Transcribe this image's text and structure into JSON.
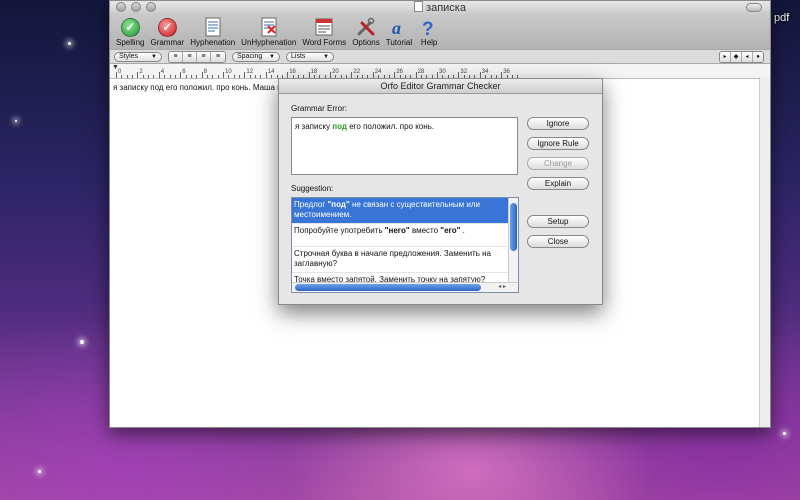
{
  "desktop": {
    "label": "pdf"
  },
  "window": {
    "title": "записка",
    "toolbar": [
      {
        "id": "spelling",
        "label": "Spelling",
        "icon": "spelling-check-icon"
      },
      {
        "id": "grammar",
        "label": "Grammar",
        "icon": "grammar-check-icon"
      },
      {
        "id": "hyphenation",
        "label": "Hyphenation",
        "icon": "hyphenation-icon"
      },
      {
        "id": "unhyphenation",
        "label": "UnHyphenation",
        "icon": "unhyphenation-icon"
      },
      {
        "id": "wordforms",
        "label": "Word Forms",
        "icon": "word-forms-icon"
      },
      {
        "id": "options",
        "label": "Options",
        "icon": "tools-icon"
      },
      {
        "id": "tutorial",
        "label": "Tutorial",
        "icon": "tutorial-icon"
      },
      {
        "id": "help",
        "label": "Help",
        "icon": "help-icon"
      }
    ],
    "format": {
      "styles": "Styles",
      "spacing": "Spacing",
      "lists": "Lists"
    },
    "ruler_numbers": [
      "0",
      "2",
      "4",
      "6",
      "8",
      "10",
      "12",
      "14",
      "16",
      "18",
      "20",
      "22",
      "24",
      "26",
      "28",
      "30",
      "32",
      "34",
      "36"
    ],
    "document_text": "я записку под его положил. про конь. Маша ш"
  },
  "dialog": {
    "title": "Orfo Editor Grammar Checker",
    "error_label": "Grammar Error:",
    "error_before": "я записку ",
    "error_word": "под",
    "error_after": " его положил. про конь.",
    "suggestion_label": "Suggestion:",
    "suggestions": [
      {
        "pre": "Предлог ",
        "bold": "\"под\"",
        "post": " не связан с существительным или местоимением."
      },
      {
        "pre": "Попробуйте употребить ",
        "bold": "\"него\"",
        "mid": " вместо ",
        "bold2": "\"его\"",
        "post": " ."
      },
      {
        "pre": "Строчная буква в начале предложения. Заменить на заглавную?"
      },
      {
        "pre": "Точка вместо запятой. Заменить точку на запятую?"
      }
    ],
    "buttons": {
      "ignore": "Ignore",
      "ignore_rule": "Ignore Rule",
      "change": "Change",
      "explain": "Explain",
      "setup": "Setup",
      "close": "Close"
    }
  }
}
